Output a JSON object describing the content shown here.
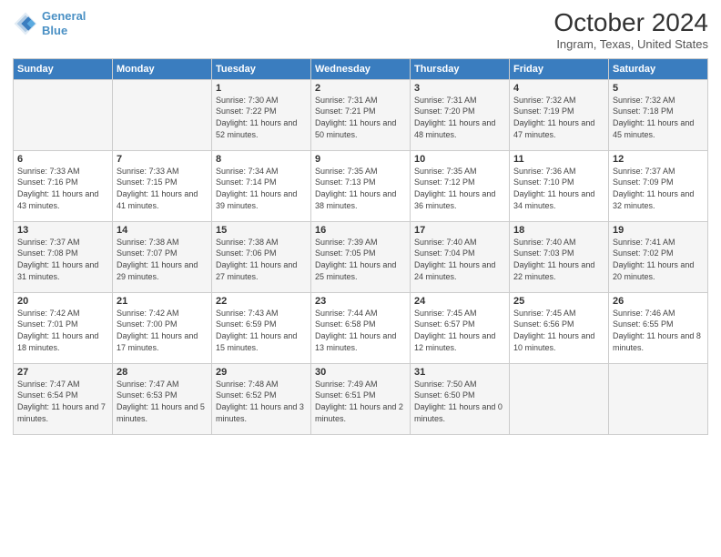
{
  "header": {
    "logo_line1": "General",
    "logo_line2": "Blue",
    "month": "October 2024",
    "location": "Ingram, Texas, United States"
  },
  "days_of_week": [
    "Sunday",
    "Monday",
    "Tuesday",
    "Wednesday",
    "Thursday",
    "Friday",
    "Saturday"
  ],
  "weeks": [
    [
      {
        "day": "",
        "info": ""
      },
      {
        "day": "",
        "info": ""
      },
      {
        "day": "1",
        "info": "Sunrise: 7:30 AM\nSunset: 7:22 PM\nDaylight: 11 hours and 52 minutes."
      },
      {
        "day": "2",
        "info": "Sunrise: 7:31 AM\nSunset: 7:21 PM\nDaylight: 11 hours and 50 minutes."
      },
      {
        "day": "3",
        "info": "Sunrise: 7:31 AM\nSunset: 7:20 PM\nDaylight: 11 hours and 48 minutes."
      },
      {
        "day": "4",
        "info": "Sunrise: 7:32 AM\nSunset: 7:19 PM\nDaylight: 11 hours and 47 minutes."
      },
      {
        "day": "5",
        "info": "Sunrise: 7:32 AM\nSunset: 7:18 PM\nDaylight: 11 hours and 45 minutes."
      }
    ],
    [
      {
        "day": "6",
        "info": "Sunrise: 7:33 AM\nSunset: 7:16 PM\nDaylight: 11 hours and 43 minutes."
      },
      {
        "day": "7",
        "info": "Sunrise: 7:33 AM\nSunset: 7:15 PM\nDaylight: 11 hours and 41 minutes."
      },
      {
        "day": "8",
        "info": "Sunrise: 7:34 AM\nSunset: 7:14 PM\nDaylight: 11 hours and 39 minutes."
      },
      {
        "day": "9",
        "info": "Sunrise: 7:35 AM\nSunset: 7:13 PM\nDaylight: 11 hours and 38 minutes."
      },
      {
        "day": "10",
        "info": "Sunrise: 7:35 AM\nSunset: 7:12 PM\nDaylight: 11 hours and 36 minutes."
      },
      {
        "day": "11",
        "info": "Sunrise: 7:36 AM\nSunset: 7:10 PM\nDaylight: 11 hours and 34 minutes."
      },
      {
        "day": "12",
        "info": "Sunrise: 7:37 AM\nSunset: 7:09 PM\nDaylight: 11 hours and 32 minutes."
      }
    ],
    [
      {
        "day": "13",
        "info": "Sunrise: 7:37 AM\nSunset: 7:08 PM\nDaylight: 11 hours and 31 minutes."
      },
      {
        "day": "14",
        "info": "Sunrise: 7:38 AM\nSunset: 7:07 PM\nDaylight: 11 hours and 29 minutes."
      },
      {
        "day": "15",
        "info": "Sunrise: 7:38 AM\nSunset: 7:06 PM\nDaylight: 11 hours and 27 minutes."
      },
      {
        "day": "16",
        "info": "Sunrise: 7:39 AM\nSunset: 7:05 PM\nDaylight: 11 hours and 25 minutes."
      },
      {
        "day": "17",
        "info": "Sunrise: 7:40 AM\nSunset: 7:04 PM\nDaylight: 11 hours and 24 minutes."
      },
      {
        "day": "18",
        "info": "Sunrise: 7:40 AM\nSunset: 7:03 PM\nDaylight: 11 hours and 22 minutes."
      },
      {
        "day": "19",
        "info": "Sunrise: 7:41 AM\nSunset: 7:02 PM\nDaylight: 11 hours and 20 minutes."
      }
    ],
    [
      {
        "day": "20",
        "info": "Sunrise: 7:42 AM\nSunset: 7:01 PM\nDaylight: 11 hours and 18 minutes."
      },
      {
        "day": "21",
        "info": "Sunrise: 7:42 AM\nSunset: 7:00 PM\nDaylight: 11 hours and 17 minutes."
      },
      {
        "day": "22",
        "info": "Sunrise: 7:43 AM\nSunset: 6:59 PM\nDaylight: 11 hours and 15 minutes."
      },
      {
        "day": "23",
        "info": "Sunrise: 7:44 AM\nSunset: 6:58 PM\nDaylight: 11 hours and 13 minutes."
      },
      {
        "day": "24",
        "info": "Sunrise: 7:45 AM\nSunset: 6:57 PM\nDaylight: 11 hours and 12 minutes."
      },
      {
        "day": "25",
        "info": "Sunrise: 7:45 AM\nSunset: 6:56 PM\nDaylight: 11 hours and 10 minutes."
      },
      {
        "day": "26",
        "info": "Sunrise: 7:46 AM\nSunset: 6:55 PM\nDaylight: 11 hours and 8 minutes."
      }
    ],
    [
      {
        "day": "27",
        "info": "Sunrise: 7:47 AM\nSunset: 6:54 PM\nDaylight: 11 hours and 7 minutes."
      },
      {
        "day": "28",
        "info": "Sunrise: 7:47 AM\nSunset: 6:53 PM\nDaylight: 11 hours and 5 minutes."
      },
      {
        "day": "29",
        "info": "Sunrise: 7:48 AM\nSunset: 6:52 PM\nDaylight: 11 hours and 3 minutes."
      },
      {
        "day": "30",
        "info": "Sunrise: 7:49 AM\nSunset: 6:51 PM\nDaylight: 11 hours and 2 minutes."
      },
      {
        "day": "31",
        "info": "Sunrise: 7:50 AM\nSunset: 6:50 PM\nDaylight: 11 hours and 0 minutes."
      },
      {
        "day": "",
        "info": ""
      },
      {
        "day": "",
        "info": ""
      }
    ]
  ]
}
